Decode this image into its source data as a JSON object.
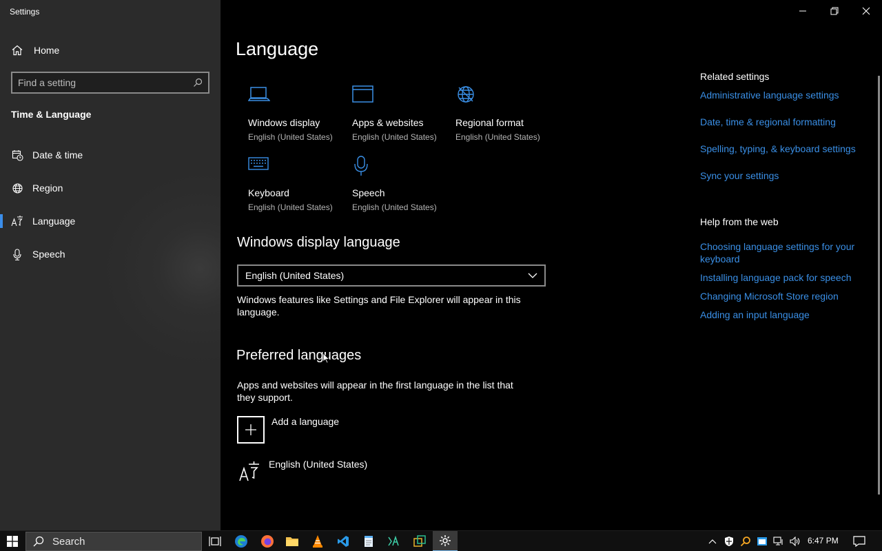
{
  "window": {
    "title": "Settings",
    "controls": {
      "minimize": "minimize-icon",
      "restore": "restore-icon",
      "close": "close-icon"
    }
  },
  "sidebar": {
    "home_label": "Home",
    "search_placeholder": "Find a setting",
    "section_title": "Time & Language",
    "items": [
      {
        "label": "Date & time",
        "icon": "calendar-clock-icon"
      },
      {
        "label": "Region",
        "icon": "globe-icon"
      },
      {
        "label": "Language",
        "icon": "language-icon",
        "active": true
      },
      {
        "label": "Speech",
        "icon": "microphone-icon"
      }
    ]
  },
  "main": {
    "title": "Language",
    "tiles": [
      {
        "name": "Windows display",
        "sub": "English (United States)",
        "icon": "laptop-icon"
      },
      {
        "name": "Apps & websites",
        "sub": "English (United States)",
        "icon": "browser-window-icon"
      },
      {
        "name": "Regional format",
        "sub": "English (United States)",
        "icon": "globe-format-icon"
      },
      {
        "name": "Keyboard",
        "sub": "English (United States)",
        "icon": "keyboard-icon"
      },
      {
        "name": "Speech",
        "sub": "English (United States)",
        "icon": "microphone-icon"
      }
    ],
    "display_language": {
      "heading": "Windows display language",
      "selected": "English (United States)",
      "description": "Windows features like Settings and File Explorer will appear in this language."
    },
    "preferred": {
      "heading": "Preferred languages",
      "description": "Apps and websites will appear in the first language in the list that they support.",
      "add_label": "Add a language",
      "languages": [
        {
          "name": "English (United States)"
        }
      ]
    }
  },
  "related": {
    "heading": "Related settings",
    "links": [
      "Administrative language settings",
      "Date, time & regional formatting",
      "Spelling, typing, & keyboard settings",
      "Sync your settings"
    ],
    "help_heading": "Help from the web",
    "help_links": [
      "Choosing language settings for your keyboard",
      "Installing language pack for speech",
      "Changing Microsoft Store region",
      "Adding an input language"
    ]
  },
  "taskbar": {
    "search_label": "Search",
    "apps": [
      "task-view-icon",
      "edge-icon",
      "firefox-icon",
      "file-explorer-icon",
      "vlc-icon",
      "vscode-icon",
      "notepad-icon",
      "app-icon",
      "window-app-icon",
      "settings-gear-icon"
    ],
    "clock": "6:47 PM"
  },
  "colors": {
    "accent": "#3a8fe6",
    "sidebar_bg": "#2b2b2b",
    "main_bg": "#000000",
    "taskbar_bg": "#101010"
  }
}
